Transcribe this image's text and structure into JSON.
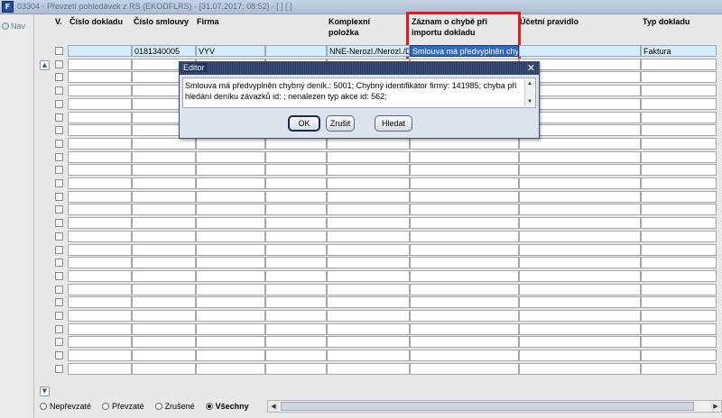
{
  "window": {
    "title": "03304 - Převzetí pohledávek z RS (EKODFLRS) - [31.07.2017; 08:52] - [ ] [ ]",
    "app_icon_letter": "F"
  },
  "nav": {
    "label": "Nav",
    "icon": "nav-icon"
  },
  "columns": {
    "v": "V.",
    "cislo_dokladu": "Číslo dokladu",
    "cislo_smlouvy": "Číslo smlouvy",
    "firma": "Firma",
    "komplexni_polozka_1": "Komplexní",
    "komplexni_polozka_2": "položka",
    "zaznam_1": "Záznam o chybě při",
    "zaznam_2": "importu dokladu",
    "ucetni_pravidlo": "Účetní pravidlo",
    "typ_dokladu": "Typ dokladu"
  },
  "first_row": {
    "cislo_smlouvy": "0181340005",
    "firma": "VYV",
    "komplexni_polozka": "NNE-Nerozl./Nerozl./D",
    "zaznam": "Smlouva má předvyplněn chyb",
    "typ_dokladu": "Faktura"
  },
  "filter": {
    "options": [
      {
        "label": "Nepřevzaté",
        "selected": false
      },
      {
        "label": "Převzaté",
        "selected": false
      },
      {
        "label": "Zrušené",
        "selected": false
      },
      {
        "label": "Všechny",
        "selected": true
      }
    ]
  },
  "editor_dialog": {
    "title": "Editor",
    "text": "Smlouva má předvyplněn chybný deník.: 5001; Chybný identifikátor firmy: 141985; chyba při hledání deníku závazků id: ; nenalezen typ akce id: 562;",
    "ok_label": "OK",
    "cancel_label": "Zrušit",
    "find_label": "Hledat"
  },
  "colors": {
    "highlight": "#e41a1a",
    "selected_row": "#d7ecfb",
    "focus_cell": "#316ac5",
    "title_bar": "#22345a"
  }
}
